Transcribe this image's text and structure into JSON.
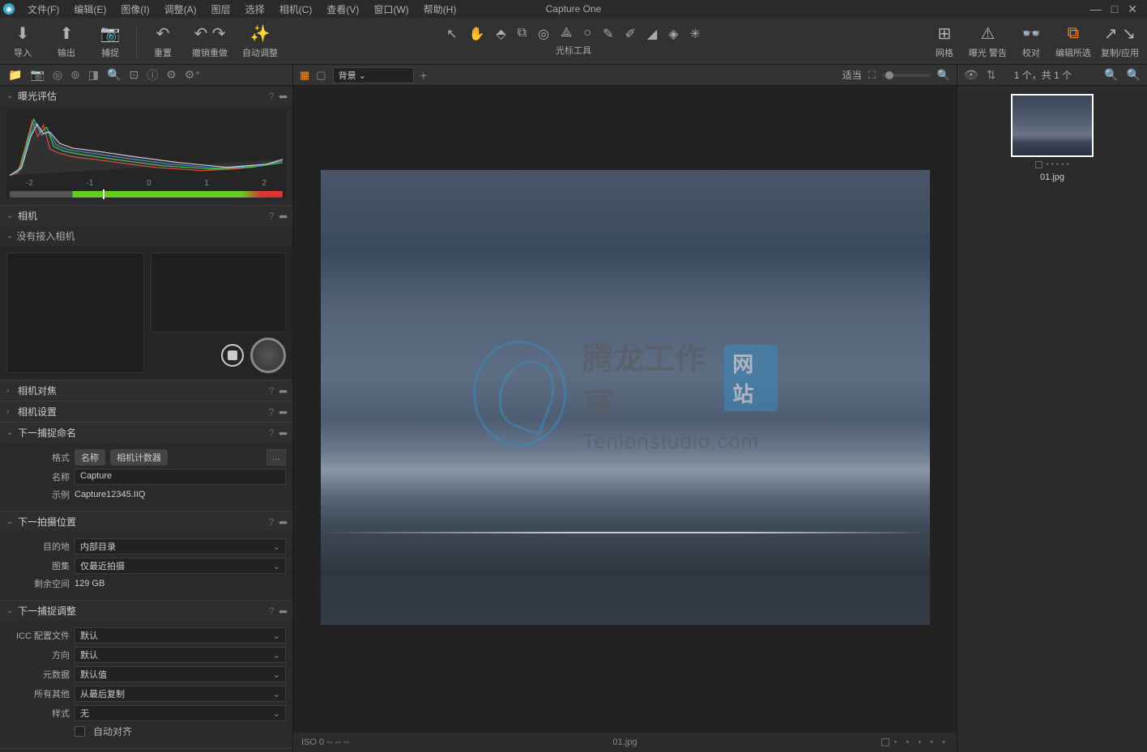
{
  "app": {
    "title": "Capture One"
  },
  "menu": {
    "file": "文件(F)",
    "edit": "编辑(E)",
    "image": "图像(I)",
    "adjust": "调整(A)",
    "layer": "图层",
    "select": "选择",
    "camera": "相机(C)",
    "view": "查看(V)",
    "window": "窗口(W)",
    "help": "帮助(H)"
  },
  "toolbar": {
    "import": "导入",
    "export": "输出",
    "capture": "捕捉",
    "reset": "重置",
    "undoredo": "撤销重做",
    "auto": "自动调整",
    "center_label": "光标工具",
    "grid": "网格",
    "expwarn": "曝光 警告",
    "proof": "校对",
    "editall": "编辑所选",
    "copyapply": "复制/应用"
  },
  "panels": {
    "exposure_eval": {
      "title": "曝光评估",
      "scale": [
        "-2",
        "-1",
        "0",
        "1",
        "2"
      ]
    },
    "camera": {
      "title": "相机",
      "no_camera": "没有接入相机"
    },
    "camera_focus": {
      "title": "相机对焦"
    },
    "camera_settings": {
      "title": "相机设置"
    },
    "next_name": {
      "title": "下一捕捉命名",
      "format_label": "格式",
      "tag1": "名称",
      "tag2": "相机计数器",
      "name_label": "名称",
      "name_value": "Capture",
      "example_label": "示例",
      "example_value": "Capture12345.IIQ"
    },
    "next_location": {
      "title": "下一拍摄位置",
      "dest_label": "目的地",
      "dest_value": "内部目录",
      "collection_label": "图集",
      "collection_value": "仅最近拍摄",
      "space_label": "剩余空间",
      "space_value": "129 GB"
    },
    "next_adjust": {
      "title": "下一捕捉调整",
      "icc_label": "ICC 配置文件",
      "icc_value": "默认",
      "orient_label": "方向",
      "orient_value": "默认",
      "meta_label": "元数据",
      "meta_value": "默认值",
      "other_label": "所有其他",
      "other_value": "从最后复制",
      "style_label": "样式",
      "style_value": "无",
      "autoalign": "自动对齐"
    }
  },
  "viewer": {
    "layer_select": "背景",
    "fit": "适当",
    "status_left": "ISO 0    --    --    --",
    "filename": "01.jpg"
  },
  "browser": {
    "count": "1 个，共 1 个",
    "thumb_name": "01.jpg"
  },
  "watermark": {
    "title": "腾龙工作室",
    "badge": "网站",
    "sub": "Tenlonstudio.com"
  }
}
